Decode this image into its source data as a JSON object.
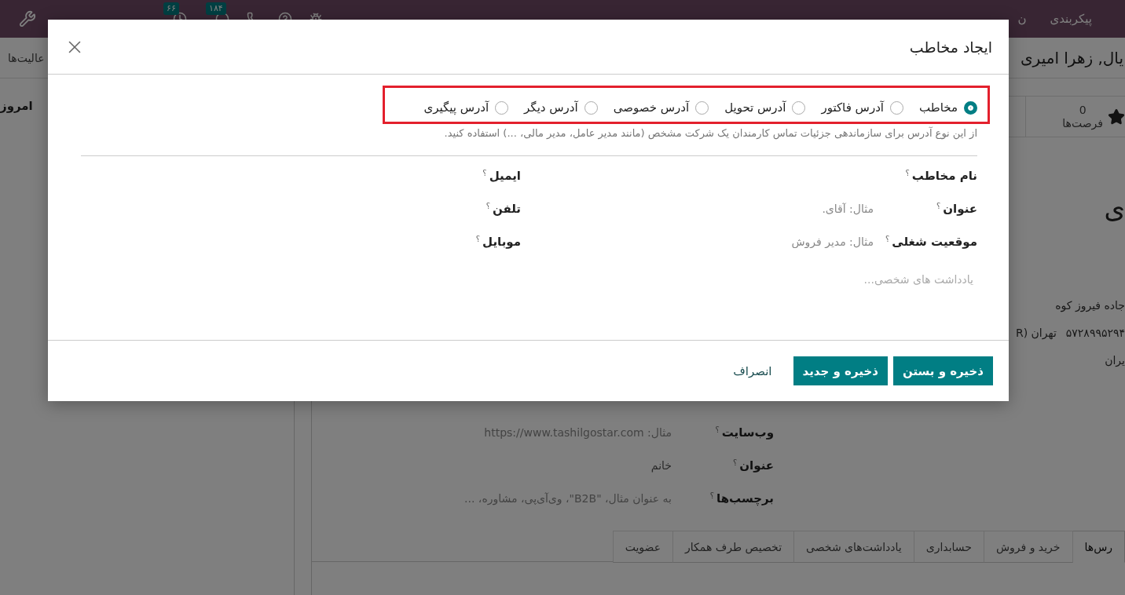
{
  "navbar": {
    "menu_items": [
      "پیکربندی",
      "ن"
    ],
    "activity_badge": "۶۶",
    "message_badge": "۱۸۴"
  },
  "breadcrumb": {
    "parent": "عالیت‌ها",
    "record": "یال, زهرا امیری"
  },
  "chatter": {
    "date_separator": "امروز"
  },
  "stat_buttons": [
    {
      "value": "0",
      "label": "فرصت‌ها"
    }
  ],
  "partner_name": "ی",
  "address": {
    "street": "جاده فیروز کوه",
    "zip": "۵۷۲۸۹۹۵۲۹۴",
    "city": "تهران (R",
    "country": "یران"
  },
  "form_fields": [
    {
      "label": "وب‌سایت",
      "help": "؟",
      "placeholder": "مثال: https://www.tashilgostar.com"
    },
    {
      "label": "عنوان",
      "help": "؟",
      "value": "خانم"
    },
    {
      "label": "برچسب‌ها",
      "help": "؟",
      "placeholder": "به عنوان مثال، \"B2B\"، وی‌آی‌پی، مشاوره، ..."
    }
  ],
  "tabs": [
    {
      "label": "رس‌ها",
      "selected": true
    },
    {
      "label": "خرید و فروش",
      "selected": false
    },
    {
      "label": "حسابداری",
      "selected": false
    },
    {
      "label": "یادداشت‌های شخصی",
      "selected": false
    },
    {
      "label": "تخصیص طرف همکار",
      "selected": false
    },
    {
      "label": "عضویت",
      "selected": false
    }
  ],
  "modal": {
    "title": "ایجاد مخاطب",
    "address_types_highlighted": true,
    "address_types": [
      {
        "label": "مخاطب",
        "selected": true
      },
      {
        "label": "آدرس فاکتور",
        "selected": false
      },
      {
        "label": "آدرس تحویل",
        "selected": false
      },
      {
        "label": "آدرس خصوصی",
        "selected": false
      },
      {
        "label": "آدرس دیگر",
        "selected": false
      },
      {
        "label": "آدرس پیگیری",
        "selected": false
      }
    ],
    "description": "از این نوع آدرس برای سازماندهی جزئیات تماس کارمندان یک شرکت مشخص (مانند مدیر عامل، مدیر مالی، ...) استفاده کنید.",
    "fields_right": [
      {
        "label": "نام مخاطب",
        "help": "؟"
      },
      {
        "label": "عنوان",
        "help": "؟",
        "placeholder": "مثال: آقای."
      },
      {
        "label": "موقعیت شغلی",
        "help": "؟",
        "placeholder": "مثال: مدیر فروش"
      }
    ],
    "fields_left": [
      {
        "label": "ایمیل",
        "help": "؟"
      },
      {
        "label": "تلفن",
        "help": "؟"
      },
      {
        "label": "موبایل",
        "help": "؟"
      }
    ],
    "notes_placeholder": "یادداشت های شخصی...",
    "buttons": [
      {
        "label": "ذخیره و بستن",
        "kind": "primary"
      },
      {
        "label": "ذخیره و جدید",
        "kind": "primary"
      },
      {
        "label": "انصراف",
        "kind": "link"
      }
    ]
  }
}
